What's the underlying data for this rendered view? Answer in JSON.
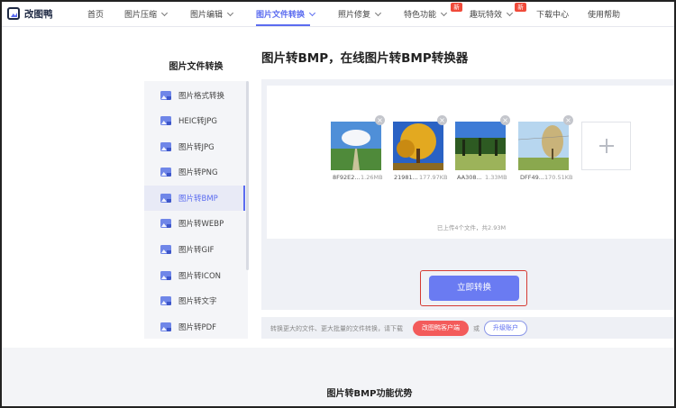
{
  "app": {
    "name": "改图鸭"
  },
  "nav": {
    "items": [
      {
        "label": "首页"
      },
      {
        "label": "图片压缩"
      },
      {
        "label": "图片编辑"
      },
      {
        "label": "图片文件转换"
      },
      {
        "label": "照片修复"
      },
      {
        "label": "特色功能",
        "badge": "新"
      },
      {
        "label": "趣玩特效",
        "badge": "新"
      },
      {
        "label": "下载中心"
      },
      {
        "label": "使用帮助"
      }
    ],
    "active": "图片文件转换"
  },
  "sidebar": {
    "title": "图片文件转换",
    "items": [
      {
        "label": "图片格式转换"
      },
      {
        "label": "HEIC转JPG"
      },
      {
        "label": "图片转JPG"
      },
      {
        "label": "图片转PNG"
      },
      {
        "label": "图片转BMP"
      },
      {
        "label": "图片转WEBP"
      },
      {
        "label": "图片转GIF"
      },
      {
        "label": "图片转ICON"
      },
      {
        "label": "图片转文字"
      },
      {
        "label": "图片转PDF"
      }
    ],
    "active": "图片转BMP"
  },
  "main": {
    "title": "图片转BMP，在线图片转BMP转换器",
    "files": [
      {
        "name": "8F92E2...",
        "size": "1.26MB"
      },
      {
        "name": "21981...",
        "size": "177.97KB"
      },
      {
        "name": "AA308...",
        "size": "1.33MB"
      },
      {
        "name": "DFF49...",
        "size": "170.51KB"
      }
    ],
    "upload_info": "已上传4个文件，共2.93M",
    "convert_label": "立即转换",
    "tip": "转换更大的文件、更大批量的文件转换，请下载",
    "client_label": "改图鸭客户端",
    "or_label": "或",
    "upgrade_label": "升级账户"
  },
  "advantages": {
    "title": "图片转BMP功能优势"
  },
  "colors": {
    "accent": "#5b6cf0",
    "button": "#6a7bf2",
    "highlight": "#d53a32",
    "client": "#f35b5b"
  },
  "icons": [
    "duck-logo-icon",
    "chevron-down-icon",
    "image-file-icon",
    "close-icon",
    "plus-icon"
  ]
}
